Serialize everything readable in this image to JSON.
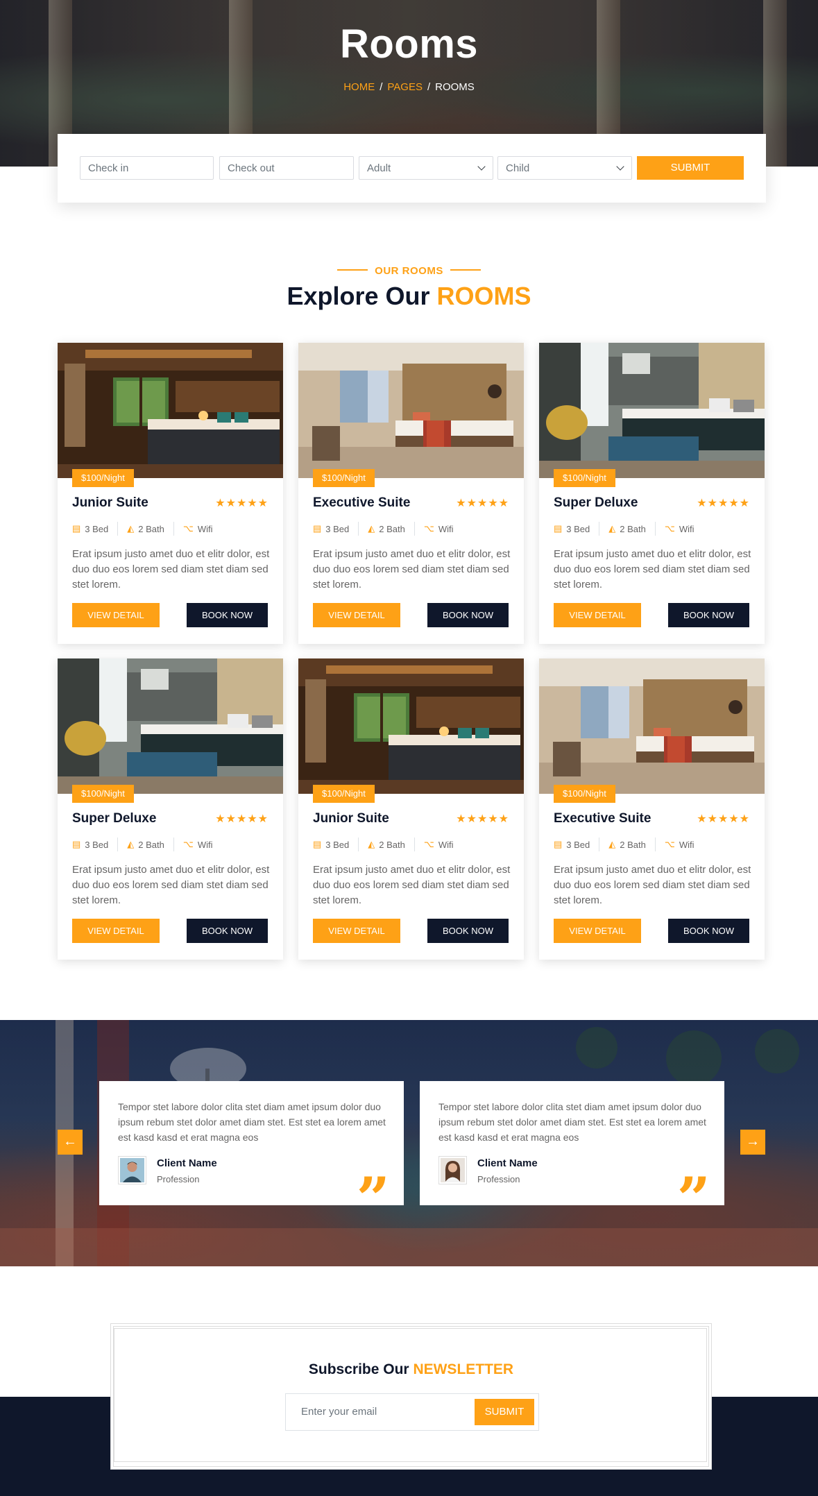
{
  "hero": {
    "title": "Rooms",
    "breadcrumb": {
      "home": "HOME",
      "pages": "PAGES",
      "current": "ROOMS",
      "separator": "/"
    }
  },
  "booking": {
    "check_in_placeholder": "Check in",
    "check_out_placeholder": "Check out",
    "adult_selected": "Adult",
    "child_selected": "Child",
    "submit_label": "SUBMIT"
  },
  "section": {
    "subtitle": "OUR ROOMS",
    "title_main": "Explore Our",
    "title_accent": "ROOMS"
  },
  "rooms": [
    {
      "price": "$100/Night",
      "name": "Junior Suite",
      "rating": 5,
      "stars": "★★★★★",
      "bed": "3 Bed",
      "bath": "2 Bath",
      "wifi": "Wifi",
      "description": "Erat ipsum justo amet duo et elitr dolor, est duo duo eos lorem sed diam stet diam sed stet lorem.",
      "view_label": "VIEW DETAIL",
      "book_label": "BOOK NOW"
    },
    {
      "price": "$100/Night",
      "name": "Executive Suite",
      "rating": 5,
      "stars": "★★★★★",
      "bed": "3 Bed",
      "bath": "2 Bath",
      "wifi": "Wifi",
      "description": "Erat ipsum justo amet duo et elitr dolor, est duo duo eos lorem sed diam stet diam sed stet lorem.",
      "view_label": "VIEW DETAIL",
      "book_label": "BOOK NOW"
    },
    {
      "price": "$100/Night",
      "name": "Super Deluxe",
      "rating": 5,
      "stars": "★★★★★",
      "bed": "3 Bed",
      "bath": "2 Bath",
      "wifi": "Wifi",
      "description": "Erat ipsum justo amet duo et elitr dolor, est duo duo eos lorem sed diam stet diam sed stet lorem.",
      "view_label": "VIEW DETAIL",
      "book_label": "BOOK NOW"
    },
    {
      "price": "$100/Night",
      "name": "Super Deluxe",
      "rating": 5,
      "stars": "★★★★★",
      "bed": "3 Bed",
      "bath": "2 Bath",
      "wifi": "Wifi",
      "description": "Erat ipsum justo amet duo et elitr dolor, est duo duo eos lorem sed diam stet diam sed stet lorem.",
      "view_label": "VIEW DETAIL",
      "book_label": "BOOK NOW"
    },
    {
      "price": "$100/Night",
      "name": "Junior Suite",
      "rating": 5,
      "stars": "★★★★★",
      "bed": "3 Bed",
      "bath": "2 Bath",
      "wifi": "Wifi",
      "description": "Erat ipsum justo amet duo et elitr dolor, est duo duo eos lorem sed diam stet diam sed stet lorem.",
      "view_label": "VIEW DETAIL",
      "book_label": "BOOK NOW"
    },
    {
      "price": "$100/Night",
      "name": "Executive Suite",
      "rating": 5,
      "stars": "★★★★★",
      "bed": "3 Bed",
      "bath": "2 Bath",
      "wifi": "Wifi",
      "description": "Erat ipsum justo amet duo et elitr dolor, est duo duo eos lorem sed diam stet diam sed stet lorem.",
      "view_label": "VIEW DETAIL",
      "book_label": "BOOK NOW"
    }
  ],
  "testimonials": [
    {
      "text": "Tempor stet labore dolor clita stet diam amet ipsum dolor duo ipsum rebum stet dolor amet diam stet. Est stet ea lorem amet est kasd kasd et erat magna eos",
      "name": "Client Name",
      "profession": "Profession"
    },
    {
      "text": "Tempor stet labore dolor clita stet diam amet ipsum dolor duo ipsum rebum stet dolor amet diam stet. Est stet ea lorem amet est kasd kasd et erat magna eos",
      "name": "Client Name",
      "profession": "Profession"
    }
  ],
  "carousel": {
    "prev_icon": "arrow-left-icon",
    "next_icon": "arrow-right-icon"
  },
  "newsletter": {
    "title_main": "Subscribe Our",
    "title_accent": "NEWSLETTER",
    "email_placeholder": "Enter your email",
    "submit_label": "SUBMIT"
  },
  "colors": {
    "primary": "#FEA116",
    "dark": "#0F172B",
    "text": "#666565"
  }
}
